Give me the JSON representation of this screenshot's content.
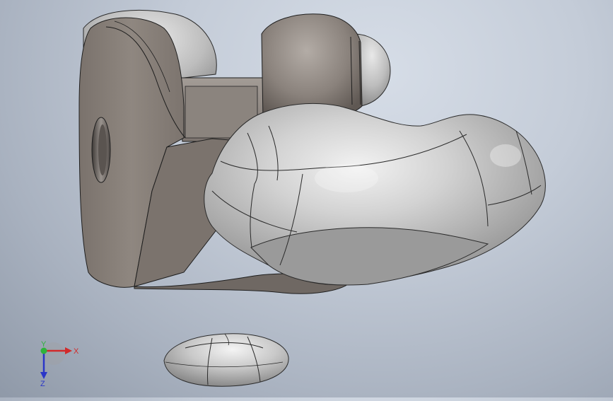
{
  "viewport": {
    "background": "#b9c1ce",
    "part_shade_gray": "#8f8883",
    "part_shade_light": "#d7d7d7"
  },
  "triad": {
    "x_label": "X",
    "y_label": "Y",
    "z_label": "Z",
    "x_color": "#d22a2a",
    "y_color": "#2fb33a",
    "z_color": "#2a36c8"
  }
}
